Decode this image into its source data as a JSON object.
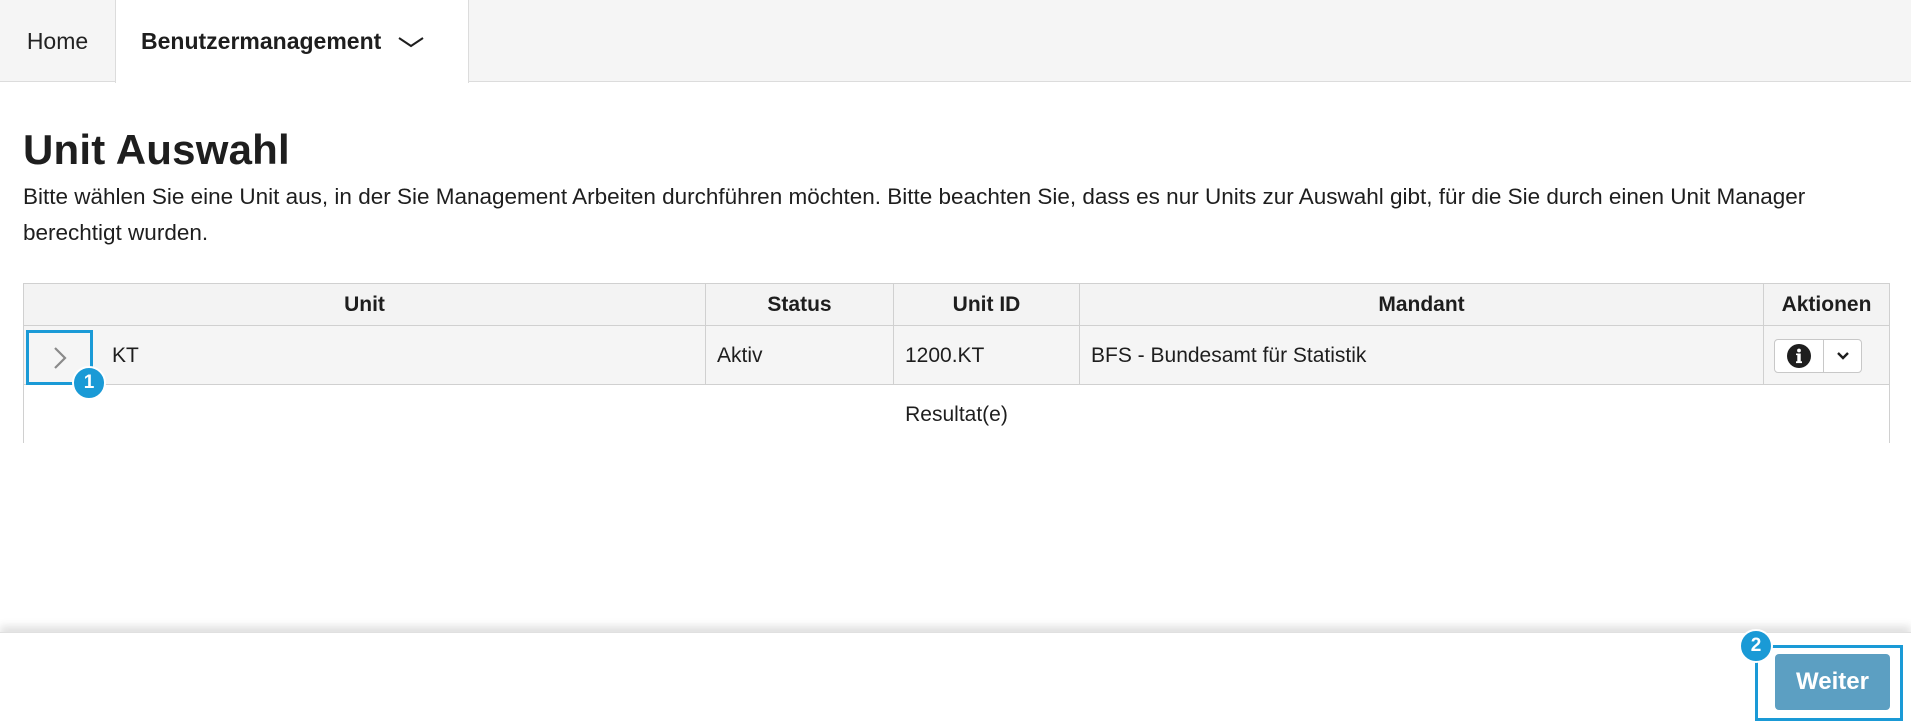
{
  "nav": {
    "home_label": "Home",
    "active_label": "Benutzermanagement"
  },
  "page": {
    "title": "Unit Auswahl",
    "description": "Bitte wählen Sie eine Unit aus, in der Sie Management Arbeiten durchführen möchten. Bitte beachten Sie, dass es nur Units zur Auswahl gibt, für die Sie durch einen Unit Manager berechtigt wurden."
  },
  "table": {
    "columns": [
      "Unit",
      "Status",
      "Unit ID",
      "Mandant",
      "Aktionen"
    ],
    "rows": [
      {
        "unit": "KT",
        "status": "Aktiv",
        "unit_id": "1200.KT",
        "mandant": "BFS - Bundesamt für Statistik"
      }
    ],
    "footer": "Resultat(e)"
  },
  "badges": [
    "1",
    "2"
  ],
  "footer_bar": {
    "next_label": "Weiter"
  },
  "colors": {
    "accent": "#1a9ad6",
    "primary_button": "#5c9fc2"
  }
}
